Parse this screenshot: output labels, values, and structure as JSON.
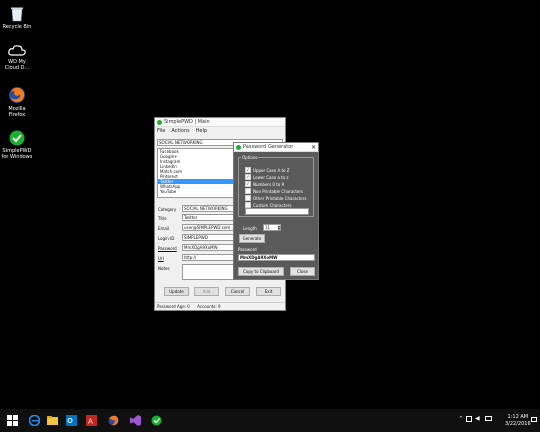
{
  "desktop": {
    "icons": [
      {
        "label": "Recycle Bin"
      },
      {
        "label": "WD My\nCloud D..."
      },
      {
        "label": "Mozilla\nFirefox"
      },
      {
        "label": "SimplePWD\nfor Windows"
      }
    ]
  },
  "main_window": {
    "title": "SimplePWD | Main",
    "menu": [
      "File",
      "Actions",
      "Help"
    ],
    "category_select": "SOCIAL NETWORKING",
    "list_items": [
      "Facebook",
      "Google+",
      "Instagram",
      "LinkedIn",
      "Match.com",
      "Pinterest",
      "Twitter",
      "WhatsApp",
      "YouTube"
    ],
    "selected_index": 6,
    "labels": {
      "category": "Category",
      "title": "Title",
      "email": "Email",
      "login_id": "Login ID",
      "password": "Password",
      "url": "Url",
      "notes": "Notes"
    },
    "values": {
      "category": "SOCIAL NETWORKING",
      "title": "Twitter",
      "email": "user@SIMPLEPWD.com",
      "login_id": "SIMPLEPWD",
      "password": "MmXDgA9XoMW",
      "url": "http://",
      "notes": ""
    },
    "buttons": {
      "update": "Update",
      "add": "Add",
      "cancel": "Cancel",
      "exit": "Exit"
    },
    "status": {
      "age": "Password Age: 0",
      "accounts": "Accounts: 9"
    }
  },
  "generator": {
    "title": "Password Generator",
    "options_label": "Options",
    "options": [
      {
        "label": "Upper Case A to Z",
        "checked": true
      },
      {
        "label": "Lower Case a to z",
        "checked": true
      },
      {
        "label": "Numbers 0 to 9",
        "checked": true
      },
      {
        "label": "Non Printable Characters",
        "checked": false
      },
      {
        "label": "Other Printable Characters",
        "checked": false
      },
      {
        "label": "Custom Characters",
        "checked": false
      }
    ],
    "length_label": "Length",
    "length_value": "11",
    "generate_label": "Generate",
    "password_label": "Password",
    "password_value": "MmXDgA9XoMW",
    "copy_label": "Copy to Clipboard",
    "close_label": "Close"
  },
  "taskbar": {
    "time": "1:12 AM",
    "date": "3/22/2016"
  }
}
